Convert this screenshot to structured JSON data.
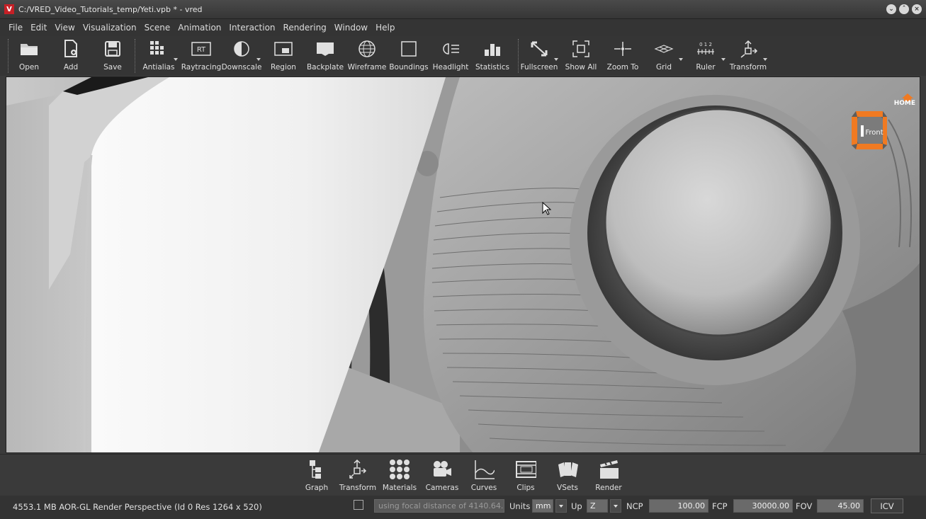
{
  "window": {
    "title": "C:/VRED_Video_Tutorials_temp/Yeti.vpb * - vred",
    "logo": "V"
  },
  "menu": [
    "File",
    "Edit",
    "View",
    "Visualization",
    "Scene",
    "Animation",
    "Interaction",
    "Rendering",
    "Window",
    "Help"
  ],
  "toolbar": {
    "open": "Open",
    "add": "Add",
    "save": "Save",
    "antialias": "Antialias",
    "raytracing": "Raytracing",
    "downscale": "Downscale",
    "region": "Region",
    "backplate": "Backplate",
    "wireframe": "Wireframe",
    "boundings": "Boundings",
    "headlight": "Headlight",
    "statistics": "Statistics",
    "fullscreen": "Fullscreen",
    "show_all": "Show All",
    "zoom_to": "Zoom To",
    "grid": "Grid",
    "ruler": "Ruler",
    "transform": "Transform",
    "rt_glyph": "RT",
    "ruler_digits": "0 1 2"
  },
  "viewport": {
    "nav_cube_face": "Front",
    "home_label": "HOME"
  },
  "modules": {
    "graph": "Graph",
    "transform": "Transform",
    "materials": "Materials",
    "cameras": "Cameras",
    "curves": "Curves",
    "clips": "Clips",
    "vsets": "VSets",
    "render": "Render"
  },
  "status": {
    "info": "4553.1 MB  AOR-GL  Render Perspective (Id 0 Res 1264 x 520)",
    "focal": "using focal distance of 4140.64...",
    "units_label": "Units",
    "units_value": "mm",
    "up_label": "Up",
    "up_value": "Z",
    "ncp_label": "NCP",
    "ncp_value": "100.00",
    "fcp_label": "FCP",
    "fcp_value": "30000.00",
    "fov_label": "FOV",
    "fov_value": "45.00",
    "icv": "ICV"
  },
  "colors": {
    "accent_orange": "#f07a22",
    "brand_red": "#c62026"
  }
}
